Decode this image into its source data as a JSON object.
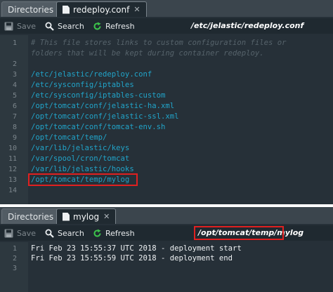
{
  "top": {
    "tabs": [
      {
        "label": "Directories"
      },
      {
        "label": "redeploy.conf"
      }
    ],
    "toolbar": {
      "save_label": "Save",
      "search_label": "Search",
      "refresh_label": "Refresh"
    },
    "path": "/etc/jelastic/redeploy.conf",
    "lines": [
      {
        "n": "1",
        "text": "# This file stores links to custom configuration files or",
        "kind": "comment"
      },
      {
        "n": "",
        "text": "folders that will be kept during container redeploy.",
        "kind": "comment"
      },
      {
        "n": "2",
        "text": "",
        "kind": "path"
      },
      {
        "n": "3",
        "text": "/etc/jelastic/redeploy.conf",
        "kind": "path"
      },
      {
        "n": "4",
        "text": "/etc/sysconfig/iptables",
        "kind": "path"
      },
      {
        "n": "5",
        "text": "/etc/sysconfig/iptables-custom",
        "kind": "path"
      },
      {
        "n": "6",
        "text": "/opt/tomcat/conf/jelastic-ha.xml",
        "kind": "path"
      },
      {
        "n": "7",
        "text": "/opt/tomcat/conf/jelastic-ssl.xml",
        "kind": "path"
      },
      {
        "n": "8",
        "text": "/opt/tomcat/conf/tomcat-env.sh",
        "kind": "path"
      },
      {
        "n": "9",
        "text": "/opt/tomcat/temp/",
        "kind": "path"
      },
      {
        "n": "10",
        "text": "/var/lib/jelastic/keys",
        "kind": "path"
      },
      {
        "n": "11",
        "text": "/var/spool/cron/tomcat",
        "kind": "path"
      },
      {
        "n": "12",
        "text": "/var/lib/jelastic/hooks",
        "kind": "path"
      },
      {
        "n": "13",
        "text": "/opt/tomcat/temp/mylog",
        "kind": "path"
      },
      {
        "n": "14",
        "text": "",
        "kind": "path"
      }
    ]
  },
  "bottom": {
    "tabs": [
      {
        "label": "Directories"
      },
      {
        "label": "mylog"
      }
    ],
    "toolbar": {
      "save_label": "Save",
      "search_label": "Search",
      "refresh_label": "Refresh"
    },
    "path": "/opt/tomcat/temp/mylog",
    "lines": [
      {
        "n": "1",
        "text": "Fri Feb 23 15:55:37 UTC 2018 - deployment start",
        "kind": "log"
      },
      {
        "n": "2",
        "text": "Fri Feb 23 15:55:59 UTC 2018 - deployment end",
        "kind": "log"
      },
      {
        "n": "3",
        "text": "",
        "kind": "log"
      }
    ]
  },
  "colors": {
    "highlight": "#e02020",
    "path_text": "#21a4c9",
    "background": "#263038"
  }
}
